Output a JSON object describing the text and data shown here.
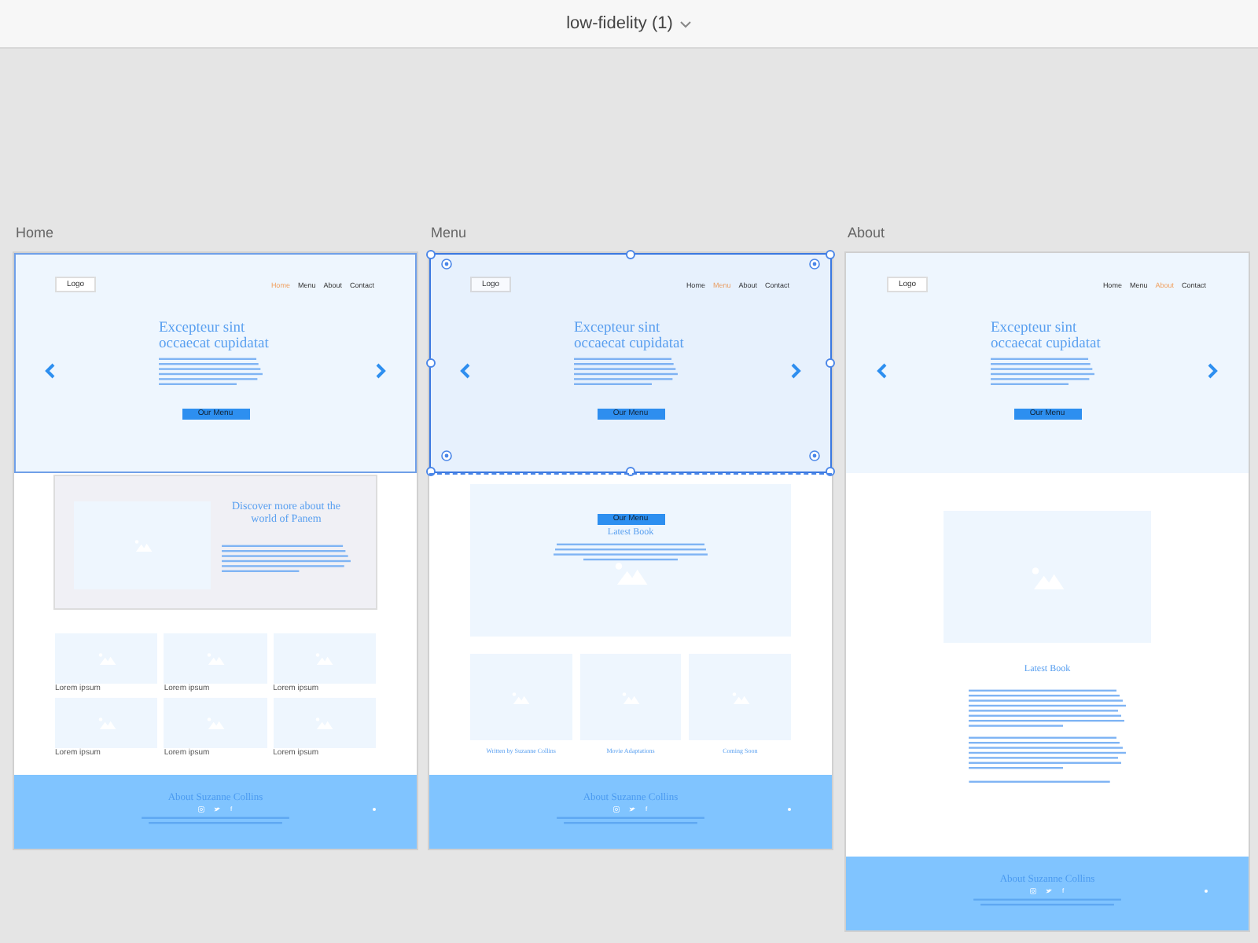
{
  "document": {
    "title": "low-fidelity (1)"
  },
  "artboards": [
    {
      "name": "Home",
      "logo": "Logo",
      "nav": [
        {
          "label": "Home",
          "selected": true
        },
        {
          "label": "Menu",
          "selected": false
        },
        {
          "label": "About",
          "selected": false
        },
        {
          "label": "Contact",
          "selected": false
        }
      ],
      "hero": {
        "hovered": true,
        "selected": false,
        "title": "Excepteur sint occaecat cupidatat",
        "button": "Our Menu"
      },
      "sections": [
        {
          "kind": "feature",
          "title": "Discover more about the world of Panem"
        },
        {
          "kind": "gallery",
          "items": [
            "Lorem ipsum",
            "Lorem ipsum",
            "Lorem ipsum",
            "Lorem ipsum",
            "Lorem ipsum",
            "Lorem ipsum"
          ]
        }
      ],
      "footer": {
        "title": "About Suzanne Collins",
        "icons": [
          {
            "kind": "camera"
          },
          {
            "kind": "bird"
          },
          {
            "kind": "glyph",
            "text": "f"
          }
        ]
      }
    },
    {
      "name": "Menu",
      "logo": "Logo",
      "nav": [
        {
          "label": "Home",
          "selected": false
        },
        {
          "label": "Menu",
          "selected": true
        },
        {
          "label": "About",
          "selected": false
        },
        {
          "label": "Contact",
          "selected": false
        }
      ],
      "hero": {
        "hovered": false,
        "selected": true,
        "title": "Excepteur sint occaecat cupidatat",
        "button": "Our Menu"
      },
      "sections": [
        {
          "kind": "book",
          "button": "Our Menu",
          "title": "Latest Book"
        },
        {
          "kind": "cards",
          "items": [
            "Written by Suzanne Collins",
            "Movie Adaptations",
            "Coming Soon"
          ]
        }
      ],
      "footer": {
        "title": "About Suzanne Collins",
        "icons": [
          {
            "kind": "camera"
          },
          {
            "kind": "bird"
          },
          {
            "kind": "glyph",
            "text": "f"
          }
        ]
      }
    },
    {
      "name": "About",
      "logo": "Logo",
      "nav": [
        {
          "label": "Home",
          "selected": false
        },
        {
          "label": "Menu",
          "selected": false
        },
        {
          "label": "About",
          "selected": true
        },
        {
          "label": "Contact",
          "selected": false
        }
      ],
      "hero": {
        "hovered": false,
        "selected": false,
        "title": "Excepteur sint occaecat cupidatat",
        "button": "Our Menu"
      },
      "sections": [
        {
          "kind": "article",
          "title": "Latest Book"
        }
      ],
      "footer": {
        "title": "About Suzanne Collins",
        "icons": [
          {
            "kind": "camera"
          },
          {
            "kind": "bird"
          },
          {
            "kind": "glyph",
            "text": "f"
          }
        ]
      }
    }
  ]
}
